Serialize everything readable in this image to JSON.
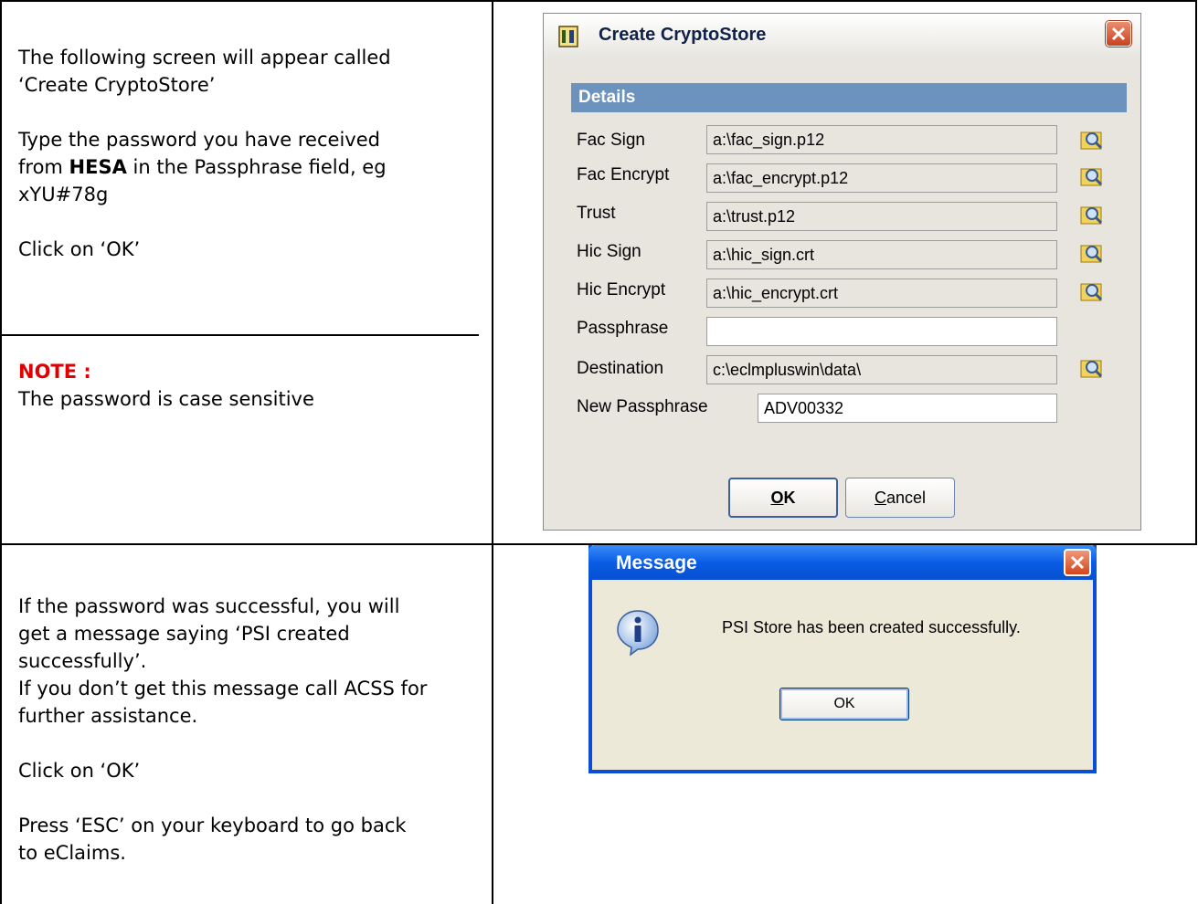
{
  "row1": {
    "intro_line1": "The following screen will appear called",
    "intro_line2": "‘Create CryptoStore’",
    "type_line1": "Type the password you have received",
    "type_line2_pre": "from ",
    "type_line2_bold": "HESA",
    "type_line2_post": " in the Passphrase field, eg",
    "type_line3": "xYU#78g",
    "click_ok": "Click on ‘OK’",
    "note_label": "NOTE :",
    "note_text": "The password is case sensitive"
  },
  "row2": {
    "line1": "If the password was successful, you will",
    "line2": "get a message saying ‘PSI created",
    "line3": "successfully’.",
    "line4": "If you don’t get this message call ACSS for",
    "line5": "further assistance.",
    "click_ok": "Click on ‘OK’",
    "esc_line1": "Press ‘ESC’ on your keyboard to go back",
    "esc_line2": "to eClaims."
  },
  "crypto_dialog": {
    "title": "Create CryptoStore",
    "section": "Details",
    "fields": [
      {
        "label": "Fac Sign",
        "value": "a:\\fac_sign.p12"
      },
      {
        "label": "Fac Encrypt",
        "value": "a:\\fac_encrypt.p12"
      },
      {
        "label": "Trust",
        "value": "a:\\trust.p12"
      },
      {
        "label": "Hic Sign",
        "value": "a:\\hic_sign.crt"
      },
      {
        "label": "Hic Encrypt",
        "value": "a:\\hic_encrypt.crt"
      },
      {
        "label": "Passphrase",
        "value": ""
      },
      {
        "label": "Destination",
        "value": "c:\\eclmpluswin\\data\\"
      },
      {
        "label": "New Passphrase",
        "value": "ADV00332"
      }
    ],
    "ok_label": "OK",
    "ok_mnemonic": "O",
    "ok_rest": "K",
    "cancel_mnemonic": "C",
    "cancel_rest": "ancel"
  },
  "message_dialog": {
    "title": "Message",
    "text": "PSI Store has been created successfully.",
    "ok_label": "OK"
  },
  "colors": {
    "note_red": "#e00000",
    "section_blue": "#6b93bd",
    "xp_title_blue": "#0a5ce6"
  }
}
